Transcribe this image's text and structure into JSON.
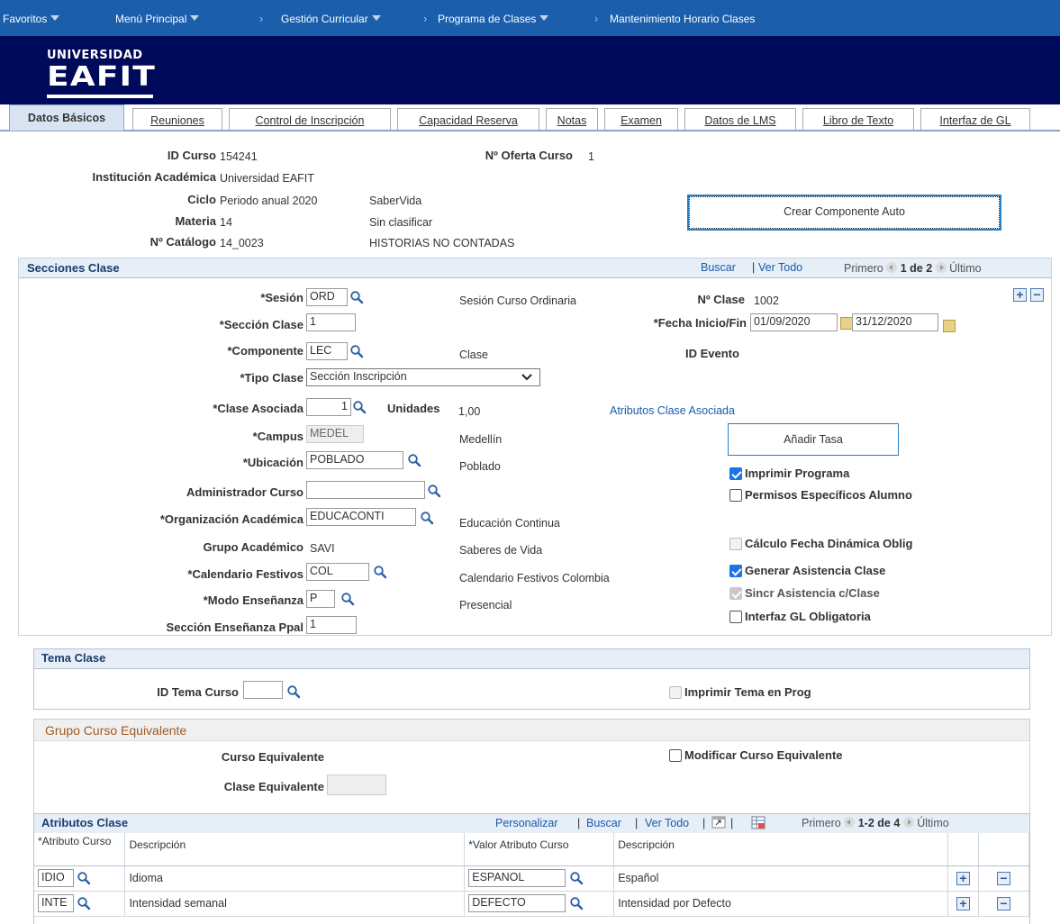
{
  "nav": {
    "favoritos": "Favoritos",
    "menu": "Menú Principal",
    "crumb1": "Gestión Curricular",
    "crumb2": "Programa de Clases",
    "crumb3": "Mantenimiento Horario Clases"
  },
  "logo": {
    "line1": "UNIVERSIDAD",
    "line2": "EAFIT"
  },
  "tabs": [
    {
      "label": "Datos Básicos"
    },
    {
      "label": "Reuniones"
    },
    {
      "label": "Control de Inscripción"
    },
    {
      "label": "Capacidad Reserva"
    },
    {
      "label": "Notas"
    },
    {
      "label": "Examen"
    },
    {
      "label": "Datos de LMS"
    },
    {
      "label": "Libro de Texto"
    },
    {
      "label": "Interfaz de GL"
    }
  ],
  "header": {
    "id_curso_label": "ID Curso",
    "id_curso": "154241",
    "oferta_label": "Nº Oferta Curso",
    "oferta": "1",
    "institucion_label": "Institución Académica",
    "institucion": "Universidad EAFIT",
    "ciclo_label": "Ciclo",
    "ciclo": "Periodo anual 2020",
    "ciclo_desc": "SaberVida",
    "materia_label": "Materia",
    "materia": "14",
    "materia_desc": "Sin clasificar",
    "catalogo_label": "Nº Catálogo",
    "catalogo": "14_0023",
    "catalogo_desc": "HISTORIAS NO CONTADAS",
    "crear_btn": "Crear Componente Auto"
  },
  "secciones": {
    "title": "Secciones Clase",
    "buscar": "Buscar",
    "ver_todo": "Ver Todo",
    "primero": "Primero",
    "count": "1 de 2",
    "ultimo": "Último",
    "sesion_label": "*Sesión",
    "sesion": "ORD",
    "sesion_desc": "Sesión Curso Ordinaria",
    "nclase_label": "Nº Clase",
    "nclase": "1002",
    "seccion_label": "*Sección Clase",
    "seccion": "1",
    "fecha_label": "*Fecha Inicio/Fin",
    "fecha_ini": "01/09/2020",
    "fecha_fin": "31/12/2020",
    "componente_label": "*Componente",
    "componente": "LEC",
    "componente_desc": "Clase",
    "id_evento_label": "ID Evento",
    "tipo_label": "*Tipo Clase",
    "tipo": "Sección Inscripción",
    "asociada_label": "*Clase Asociada",
    "asociada": "1",
    "unidades_label": "Unidades",
    "unidades": "1,00",
    "atributos_link": "Atributos Clase Asociada",
    "campus_label": "*Campus",
    "campus": "MEDEL",
    "campus_desc": "Medellín",
    "anadir_btn": "Añadir Tasa",
    "ubicacion_label": "*Ubicación",
    "ubicacion": "POBLADO",
    "ubicacion_desc": "Poblado",
    "imprimir_prog": "Imprimir Programa",
    "admin_label": "Administrador Curso",
    "admin": "",
    "permisos": "Permisos Específicos Alumno",
    "org_label": "*Organización Académica",
    "org": "EDUCACONTI",
    "org_desc": "Educación Continua",
    "grupo_label": "Grupo Académico",
    "grupo": "SAVI",
    "grupo_desc": "Saberes de Vida",
    "calculo": "Cálculo Fecha Dinámica Oblig",
    "cal_label": "*Calendario Festivos",
    "cal": "COL",
    "cal_desc": "Calendario Festivos Colombia",
    "generar": "Generar Asistencia Clase",
    "modo_label": "*Modo Enseñanza",
    "modo": "P",
    "modo_desc": "Presencial",
    "sincr": "Sincr Asistencia c/Clase",
    "interfaz": "Interfaz GL Obligatoria",
    "seccion_ppal_label": "Sección Enseñanza Ppal",
    "seccion_ppal": "1"
  },
  "tema": {
    "title": "Tema Clase",
    "id_label": "ID Tema Curso",
    "id": "",
    "imprimir": "Imprimir Tema en Prog"
  },
  "equiv": {
    "title": "Grupo Curso Equivalente",
    "curso_label": "Curso Equivalente",
    "modificar": "Modificar Curso Equivalente",
    "clase_label": "Clase Equivalente",
    "clase": ""
  },
  "atributos": {
    "title": "Atributos Clase",
    "personalizar": "Personalizar",
    "buscar": "Buscar",
    "ver_todo": "Ver Todo",
    "primero": "Primero",
    "count": "1-2 de 4",
    "ultimo": "Último",
    "col_attr": "*Atributo Curso",
    "col_desc": "Descripción",
    "col_valor": "*Valor Atributo Curso",
    "col_desc2": "Descripción",
    "rows": [
      {
        "attr": "IDIO",
        "desc": "Idioma",
        "valor": "ESPANOL",
        "desc2": "Español"
      },
      {
        "attr": "INTE",
        "desc": "Intensidad semanal",
        "valor": "DEFECTO",
        "desc2": "Intensidad por Defecto"
      }
    ]
  },
  "colors": {
    "nav": "#1b5eab",
    "banner": "#000a5a",
    "link": "#1d5aa8",
    "check": "#1a73e8"
  }
}
